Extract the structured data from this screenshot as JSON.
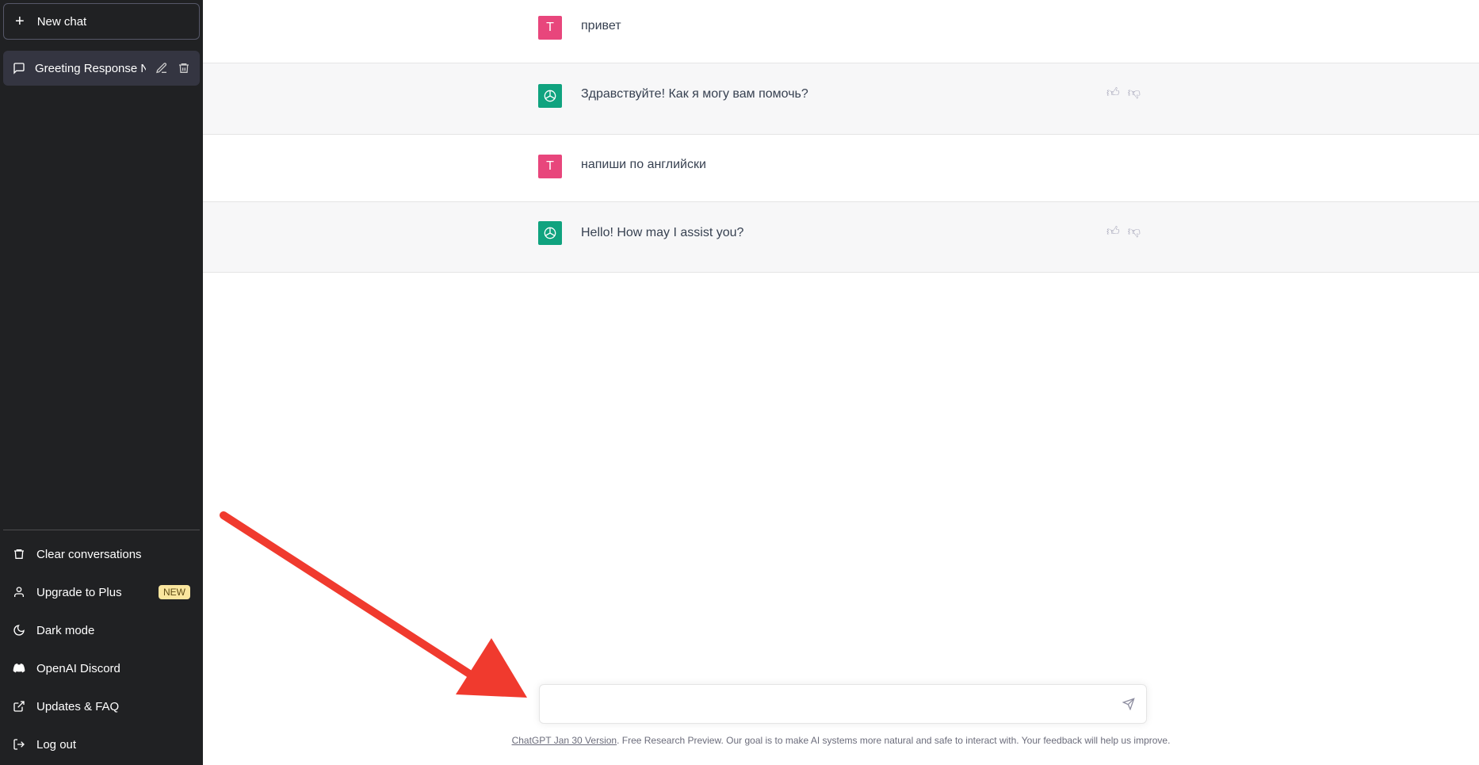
{
  "sidebar": {
    "new_chat": "New chat",
    "conversation": "Greeting Response Nee",
    "items": [
      {
        "label": "Clear conversations",
        "icon": "trash-icon"
      },
      {
        "label": "Upgrade to Plus",
        "icon": "user-icon",
        "badge": "NEW"
      },
      {
        "label": "Dark mode",
        "icon": "moon-icon"
      },
      {
        "label": "OpenAI Discord",
        "icon": "discord-icon"
      },
      {
        "label": "Updates & FAQ",
        "icon": "external-link-icon"
      },
      {
        "label": "Log out",
        "icon": "logout-icon"
      }
    ]
  },
  "messages": [
    {
      "role": "user",
      "avatar": "T",
      "text": "привет"
    },
    {
      "role": "assistant",
      "text": "Здравствуйте! Как я могу вам помочь?"
    },
    {
      "role": "user",
      "avatar": "T",
      "text": "напиши по английски"
    },
    {
      "role": "assistant",
      "text": "Hello! How may I assist you?"
    }
  ],
  "input": {
    "value": "",
    "placeholder": ""
  },
  "footer": {
    "link": "ChatGPT Jan 30 Version",
    "text": ". Free Research Preview. Our goal is to make AI systems more natural and safe to interact with. Your feedback will help us improve."
  },
  "colors": {
    "user_avatar": "#e8467c",
    "assistant_avatar": "#10a37f",
    "annotation_arrow": "#f03a2e"
  }
}
